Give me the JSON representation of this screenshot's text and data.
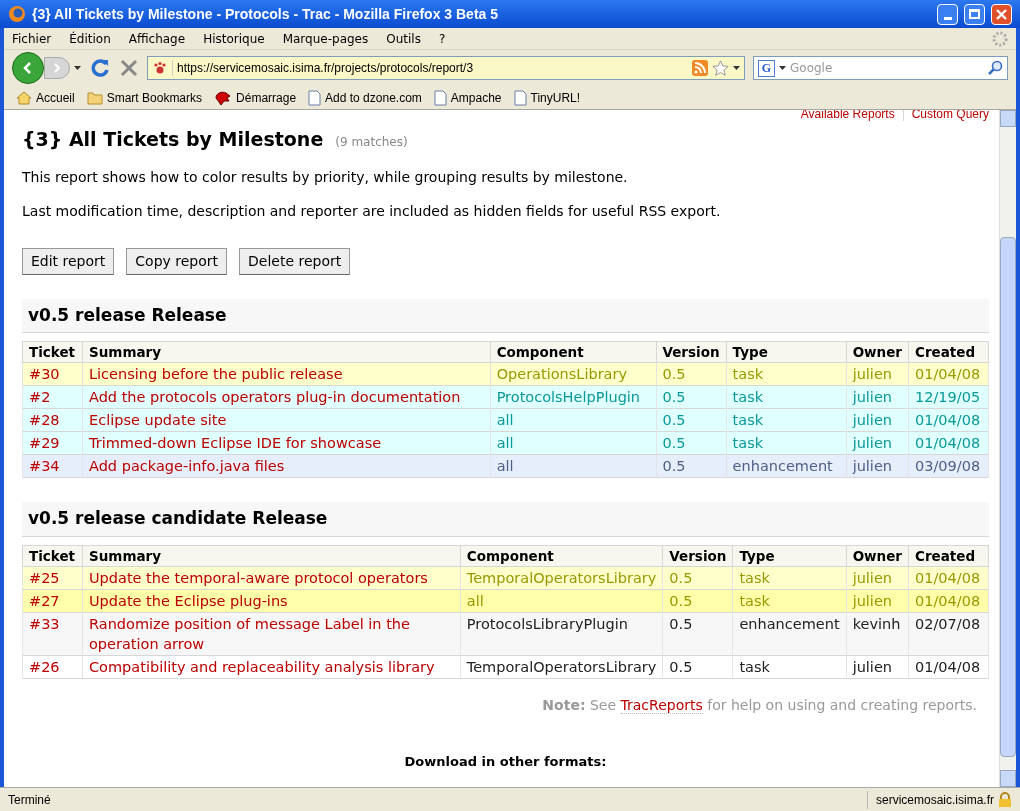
{
  "window": {
    "title": "{3} All Tickets by Milestone - Protocols - Trac - Mozilla Firefox 3 Beta 5"
  },
  "menu": [
    "Fichier",
    "Édition",
    "Affichage",
    "Historique",
    "Marque-pages",
    "Outils",
    "?"
  ],
  "address": {
    "value": "https://servicemosaic.isima.fr/projects/protocols/report/3"
  },
  "search": {
    "placeholder": "Google",
    "engine_glyph": "G"
  },
  "bookmarks": [
    {
      "label": "Accueil",
      "kind": "home"
    },
    {
      "label": "Smart Bookmarks",
      "kind": "folder"
    },
    {
      "label": "Démarrage",
      "kind": "logo"
    },
    {
      "label": "Add to dzone.com",
      "kind": "page"
    },
    {
      "label": "Ampache",
      "kind": "page"
    },
    {
      "label": "TinyURL!",
      "kind": "page"
    }
  ],
  "context_nav": [
    "Available Reports",
    "Custom Query"
  ],
  "report": {
    "title": "{3} All Tickets by Milestone",
    "matches": "(9 matches)",
    "description": [
      "This report shows how to color results by priority, while grouping results by milestone.",
      "Last modification time, description and reporter are included as hidden fields for useful RSS export."
    ],
    "buttons": [
      "Edit report",
      "Copy report",
      "Delete report"
    ]
  },
  "groups": [
    {
      "title": "v0.5 release Release",
      "columns": [
        "Ticket",
        "Summary",
        "Component",
        "Version",
        "Type",
        "Owner",
        "Created"
      ],
      "rows": [
        {
          "color": "#ffffcc",
          "cells": [
            "#30",
            "Licensing before the public release",
            "OperationsLibrary",
            "0.5",
            "task",
            "julien",
            "01/04/08"
          ]
        },
        {
          "color": "#e0ffff",
          "cells": [
            "#2",
            "Add the protocols operators plug-in documentation",
            "ProtocolsHelpPlugin",
            "0.5",
            "task",
            "julien",
            "12/19/05"
          ]
        },
        {
          "color": "#e0ffff",
          "cells": [
            "#28",
            "Eclipse update site",
            "all",
            "0.5",
            "task",
            "julien",
            "01/04/08"
          ]
        },
        {
          "color": "#e0ffff",
          "cells": [
            "#29",
            "Trimmed-down Eclipse IDE for showcase",
            "all",
            "0.5",
            "task",
            "julien",
            "01/04/08"
          ]
        },
        {
          "color": "#e7eefb",
          "cells": [
            "#34",
            "Add package-info.java files",
            "all",
            "0.5",
            "enhancement",
            "julien",
            "03/09/08"
          ]
        }
      ]
    },
    {
      "title": "v0.5 release candidate Release",
      "columns": [
        "Ticket",
        "Summary",
        "Component",
        "Version",
        "Type",
        "Owner",
        "Created"
      ],
      "rows": [
        {
          "color": "#ffffcc",
          "cells": [
            "#25",
            "Update the temporal-aware protocol operators",
            "TemporalOperatorsLibrary",
            "0.5",
            "task",
            "julien",
            "01/04/08"
          ]
        },
        {
          "color": "#ffffaa",
          "cells": [
            "#27",
            "Update the Eclipse plug-ins",
            "all",
            "0.5",
            "task",
            "julien",
            "01/04/08"
          ]
        },
        {
          "color": "#f7f7f7",
          "cells": [
            "#33",
            "Randomize position of message Label in the operation arrow",
            "ProtocolsLibraryPlugin",
            "0.5",
            "enhancement",
            "kevinh",
            "02/07/08"
          ]
        },
        {
          "color": "#ffffff",
          "cells": [
            "#26",
            "Compatibility and replaceability analysis library",
            "TemporalOperatorsLibrary",
            "0.5",
            "task",
            "julien",
            "01/04/08"
          ]
        }
      ]
    }
  ],
  "note": {
    "label": "Note:",
    "before": "See",
    "link": "TracReports",
    "after": "for help on using and creating reports."
  },
  "download": {
    "title": "Download in other formats:"
  },
  "status_bar": {
    "text": "Terminé",
    "host": "servicemosaic.isima.fr"
  }
}
